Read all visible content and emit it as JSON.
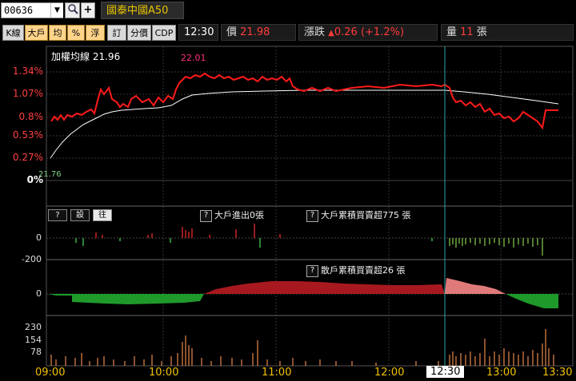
{
  "toolbar": {
    "code": "00636",
    "dropdown_glyph": "▼",
    "search_glyph": "🔍",
    "plus_glyph": "+",
    "stock_name": "國泰中國A50"
  },
  "buttons": [
    {
      "label": "K線",
      "style": "gray"
    },
    {
      "label": "大戶",
      "style": "orange"
    },
    {
      "label": "均",
      "style": "orange"
    },
    {
      "label": "%",
      "style": "orange"
    },
    {
      "label": "浮",
      "style": "orange"
    },
    {
      "label": "訂",
      "style": "gray"
    },
    {
      "label": "分價",
      "style": "gray"
    },
    {
      "label": "CDP",
      "style": "gray"
    }
  ],
  "time_display": "12:30",
  "price": {
    "label": "價",
    "value": "21.98"
  },
  "change": {
    "label": "漲跌",
    "arrow": "▲",
    "value": "0.26",
    "pct": "(+1.2%)"
  },
  "volume": {
    "label": "量",
    "value": "11",
    "unit": "張"
  },
  "main_chart": {
    "avg_label": "加權均線",
    "avg_value": "21.96",
    "high_value": "22.01",
    "low_value": "21.76",
    "y_ticks": [
      "1.34%",
      "1.07%",
      "0.8%",
      "0.53%",
      "0.27%",
      "0%"
    ]
  },
  "panel_buttons": [
    "?",
    "設",
    "往"
  ],
  "big_panel": {
    "label1": "大戶進出0張",
    "label2": "大戶累積買賣超775 張",
    "y_ticks": [
      "0",
      "-200"
    ]
  },
  "retail_panel": {
    "label": "散戶累積買賣超26 張",
    "y_ticks": [
      "0"
    ]
  },
  "volume_panel": {
    "y_ticks": [
      "230",
      "154",
      "78"
    ]
  },
  "time_axis": [
    "09:00",
    "10:00",
    "11:00",
    "12:00",
    "12:30",
    "13:00",
    "13:30"
  ],
  "colors": {
    "price_line": "#ff1a1a",
    "avg_line": "#ffffff",
    "cursor": "#2aa6a6",
    "grid": "#3a3a3a",
    "time": "#f2c200"
  }
}
